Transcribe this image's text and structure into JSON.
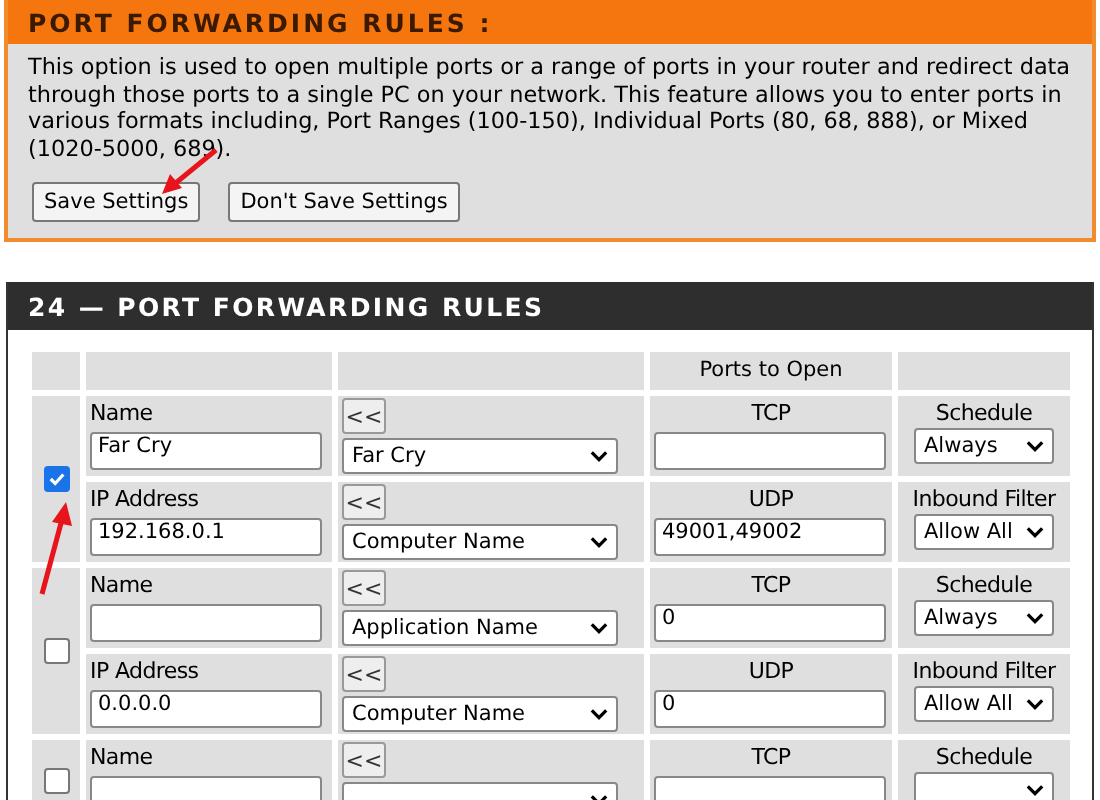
{
  "intro": {
    "title": "PORT FORWARDING RULES :",
    "description": "This option is used to open multiple ports or a range of ports in your router and redirect data through those ports to a single PC on your network. This feature allows you to enter ports in various formats including, Port Ranges (100-150), Individual Ports (80, 68, 888), or Mixed (1020-5000, 689).",
    "buttons": [
      "Save Settings",
      "Don't Save Settings"
    ]
  },
  "rules_table": {
    "title": "24 — PORT FORWARDING RULES",
    "ports_heading": "Ports to Open",
    "rules": [
      {
        "checked": true,
        "lines": [
          {
            "field_label": "Name",
            "field_value": "Far Cry",
            "button": "<<",
            "select": "Far Cry",
            "port_label": "TCP",
            "option_label": "Schedule",
            "option_value": "Always"
          },
          {
            "field_label": "IP Address",
            "field_value": "192.168.0.1",
            "button": "<<",
            "select": "Computer Name",
            "port_label": "UDP",
            "port_value": "49001,49002",
            "option_label": "Inbound Filter",
            "option_value": "Allow All"
          }
        ]
      },
      {
        "checked": false,
        "lines": [
          {
            "field_label": "Name",
            "button": "<<",
            "select": "Application Name",
            "port_label": "TCP",
            "port_value": "0",
            "option_label": "Schedule",
            "option_value": "Always"
          },
          {
            "field_label": "IP Address",
            "field_value": "0.0.0.0",
            "button": "<<",
            "select": "Computer Name",
            "port_label": "UDP",
            "port_value": "0",
            "option_label": "Inbound Filter",
            "option_value": "Allow All"
          }
        ]
      },
      {
        "checked": false,
        "lines": [
          {
            "field_label": "Name",
            "button": "<<",
            "port_label": "TCP",
            "option_label": "Schedule"
          }
        ]
      }
    ]
  }
}
